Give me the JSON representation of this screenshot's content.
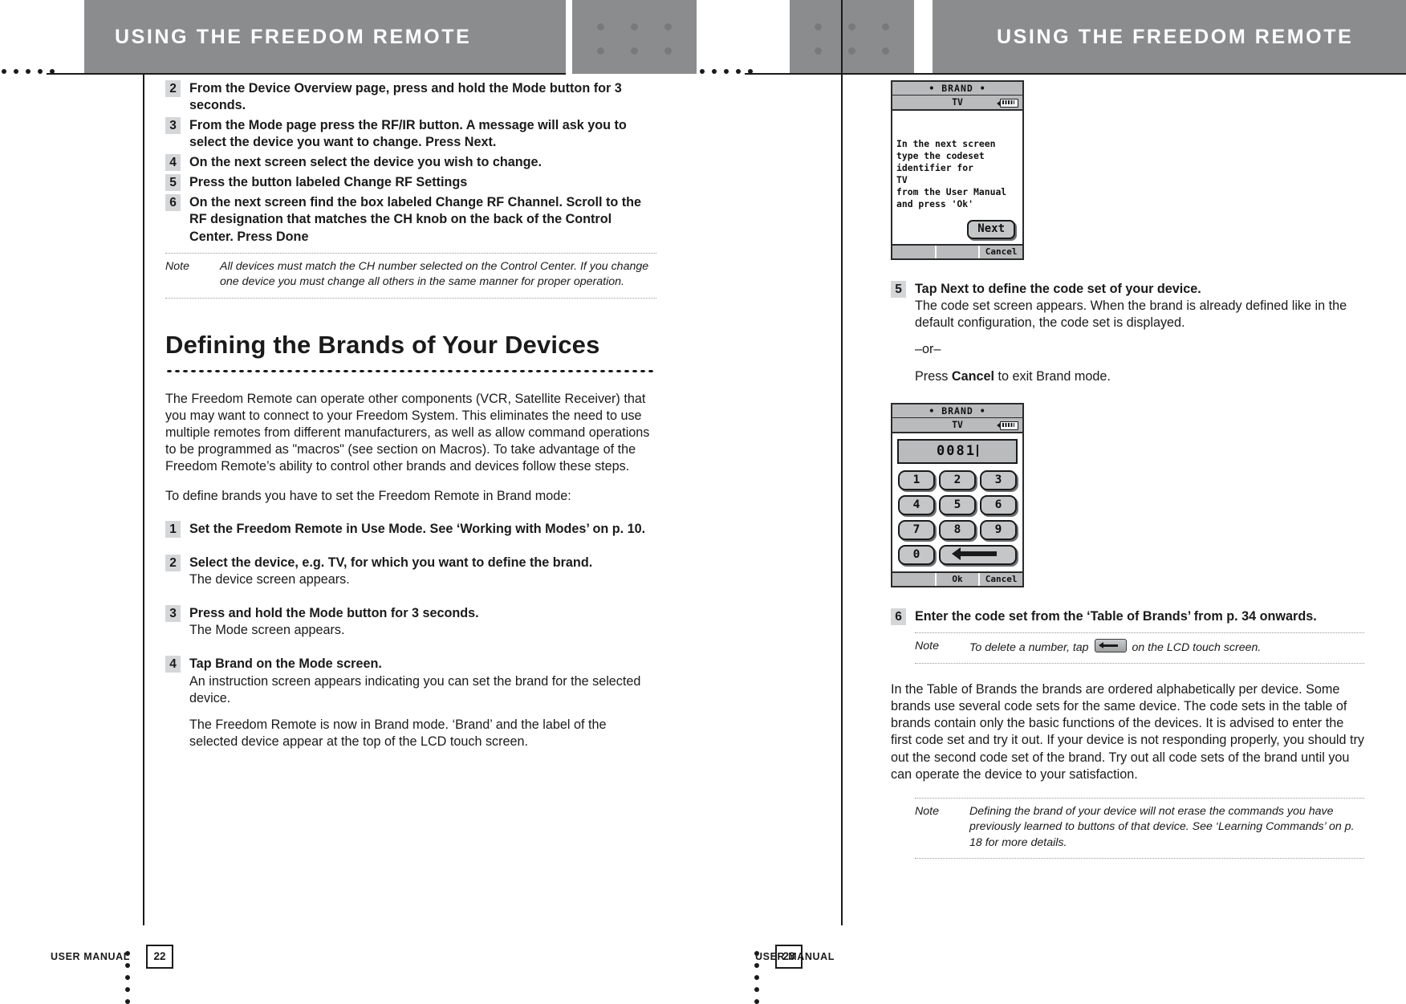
{
  "header": {
    "left_title": "USING THE FREEDOM REMOTE",
    "right_title": "USING THE FREEDOM REMOTE"
  },
  "left_page": {
    "top_steps": [
      {
        "num": "2",
        "text": "From the Device Overview page, press and hold the Mode button for 3 seconds."
      },
      {
        "num": "3",
        "text": "From the Mode page press the RF/IR button. A message will ask you to select the device you want to change. Press Next."
      },
      {
        "num": "4",
        "text": "On the next screen select the device you wish to change."
      },
      {
        "num": "5",
        "text": "Press the button labeled Change RF Settings"
      },
      {
        "num": "6",
        "text": "On the next screen find the box labeled Change RF Channel. Scroll to the RF designation that matches the CH knob on the back of the Control Center. Press Done"
      }
    ],
    "note1": {
      "label": "Note",
      "text": "All devices must match the CH number selected on the Control Center. If you change one device you must change all others in the same manner for proper operation."
    },
    "heading": "Defining the Brands of Your Devices",
    "para1": "The Freedom Remote can operate other components (VCR, Satellite Receiver) that you may want to connect to your Freedom System. This eliminates the need to use multiple remotes from different manufacturers, as well as allow command operations to be programmed as \"macros\" (see section on Macros). To take advantage of the Freedom Remote’s ability to control other brands and devices follow these steps.",
    "para2": "To define brands you have to set the Freedom Remote in Brand mode:",
    "steps": [
      {
        "num": "1",
        "lead": "Set the Freedom Remote in Use Mode. See ‘Working with Modes’ on p. 10.",
        "subs": []
      },
      {
        "num": "2",
        "lead_pre": "Select the device, e.g. TV, for which you want to define the brand.",
        "lead": "Select the device, e.g. TV, for which you want to define the brand.",
        "subs": [
          "The device screen appears."
        ]
      },
      {
        "num": "3",
        "lead_a": "Press and hold the ",
        "lead_b": "Mode",
        "lead_c": " button for 3 seconds.",
        "lead": "Press and hold the Mode button for 3 seconds.",
        "subs": [
          "The Mode screen appears."
        ]
      },
      {
        "num": "4",
        "lead_a": "Tap ",
        "lead_b": "Brand",
        "lead_c": " on the Mode screen.",
        "lead": "Tap Brand on the Mode screen.",
        "subs": [
          "An instruction screen appears indicating you can set the brand for the selected device.",
          "The Freedom Remote is now in Brand mode. ‘Brand’ and the label of the selected device appear at the top of the LCD touch screen."
        ]
      }
    ]
  },
  "right_page": {
    "lcd1": {
      "title": "• BRAND •",
      "device": "TV",
      "message": "In the next screen\ntype the codeset\nidentifier for\n          TV\nfrom the User Manual\nand press 'Ok'",
      "button": "Next",
      "foot_cancel": "Cancel"
    },
    "step5": {
      "num": "5",
      "lead_a": "Tap ",
      "lead_b": "Next",
      "lead_c": " to define the code set of your device.",
      "sub1": "The code set screen appears. When the brand is already defined like in the default configuration, the code set is displayed.",
      "or": "–or–",
      "sub2_a": "Press ",
      "sub2_b": "Cancel",
      "sub2_c": " to exit Brand mode."
    },
    "lcd2": {
      "title": "• BRAND •",
      "device": "TV",
      "code": "0081",
      "keys": [
        "1",
        "2",
        "3",
        "4",
        "5",
        "6",
        "7",
        "8",
        "9",
        "0"
      ],
      "backspace_label": "backspace",
      "foot_ok": "Ok",
      "foot_cancel": "Cancel"
    },
    "step6": {
      "num": "6",
      "text": "Enter the code set from the ‘Table of Brands’ from p. 34 onwards."
    },
    "note_delete": {
      "label": "Note",
      "text_a": "To delete a number, tap ",
      "text_b": " on the LCD touch screen."
    },
    "para": "In the Table of Brands the brands are ordered alphabetically per device. Some brands use several code sets for the same device. The code sets in the table of brands contain only the basic functions of the devices. It is advised to enter the first code set and try it out. If your device is not responding properly, you should try out the second code set of the brand. Try out all code sets of the brand until you can operate the device to your satisfaction.",
    "note_final": {
      "label": "Note",
      "text": "Defining the brand of your device will not erase the commands you have previously learned to buttons of that device. See ‘Learning Commands’ on p. 18 for more details."
    }
  },
  "footer": {
    "left_label": "USER MANUAL",
    "left_page_number": "22",
    "right_label": "USER MANUAL",
    "right_page_number": "23"
  }
}
